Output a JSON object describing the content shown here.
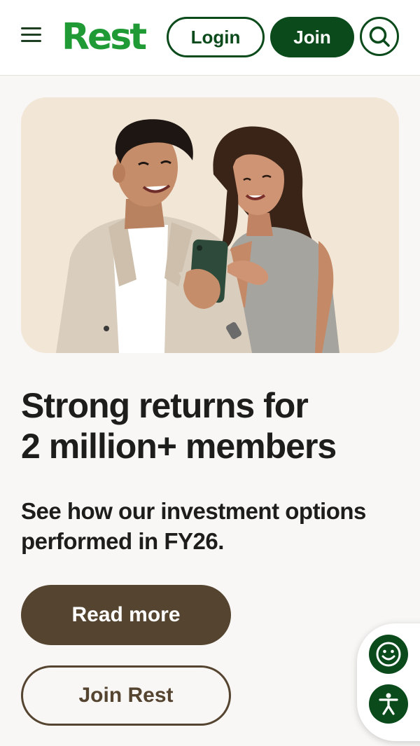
{
  "header": {
    "brand": "Rest",
    "login_label": "Login",
    "join_label": "Join"
  },
  "icons": {
    "menu": "hamburger-menu-icon",
    "search": "search-icon",
    "feedback": "smiley-face-icon",
    "accessibility": "accessibility-person-icon"
  },
  "hero": {
    "image": "photo-of-two-people-smiling-at-phone"
  },
  "main": {
    "title_line1": "Strong returns for",
    "title_line2": "2 million+ members",
    "subtitle_line1": "See how our investment options",
    "subtitle_line2": "performed in FY26.",
    "read_more_label": "Read more",
    "join_rest_label": "Join Rest"
  },
  "colors": {
    "brand_green": "#1f9a35",
    "dark_green": "#0b4a1b",
    "brown": "#554530",
    "hero_bg": "#f2e7d7",
    "page_bg": "#f8f7f5"
  }
}
